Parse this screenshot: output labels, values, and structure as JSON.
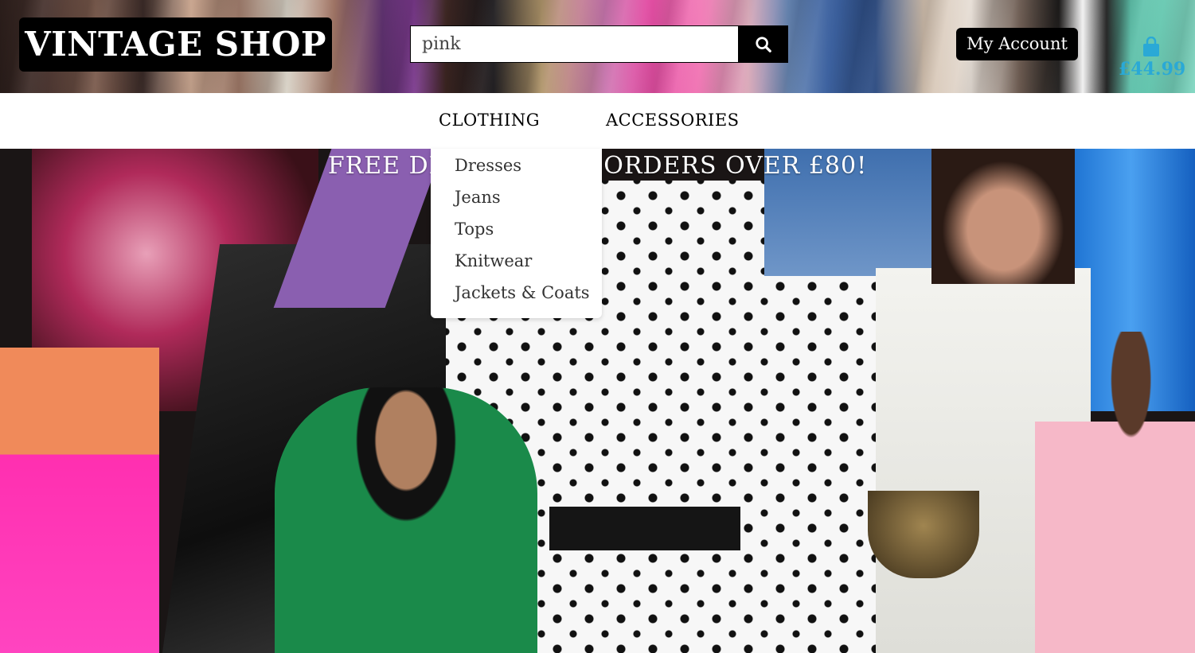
{
  "header": {
    "logo": "VINTAGE SHOP",
    "search": {
      "value": "pink",
      "button_icon": "search-icon"
    },
    "account_label": "My Account",
    "cart": {
      "icon": "shopping-bag-icon",
      "total": "£44.99",
      "color": "#2aa9d6"
    }
  },
  "nav": {
    "items": [
      {
        "label": "CLOTHING"
      },
      {
        "label": "ACCESSORIES"
      }
    ],
    "clothing_menu": [
      "Dresses",
      "Jeans",
      "Tops",
      "Knitwear",
      "Jackets & Coats"
    ]
  },
  "hero": {
    "banner": "FREE DELIVERY ON ORDERS OVER £80!"
  }
}
